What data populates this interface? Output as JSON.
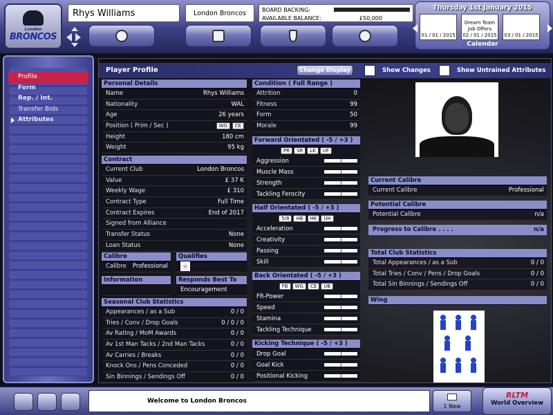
{
  "header": {
    "player_name": "Rhys Williams",
    "club": "London Broncos",
    "board_backing_label": "BOARD BACKING:",
    "available_balance_label": "AVAILABLE BALANCE:",
    "available_balance": "£50,000",
    "logo_small": "London",
    "logo_big": "BRONCOS"
  },
  "calendar": {
    "date": "Thursday 1st January 2015",
    "days": [
      {
        "event": "",
        "date": "01 / 01 / 2015"
      },
      {
        "event": "Dream Team Job Offers",
        "date": "02 / 01 / 2015"
      },
      {
        "event": "",
        "date": "03 / 01 / 2015"
      }
    ],
    "label": "Calendar"
  },
  "sidebar": {
    "items": [
      {
        "label": "Profile"
      },
      {
        "label": "Form"
      },
      {
        "label": "Rep. / Int."
      },
      {
        "label": "Transfer Bids"
      },
      {
        "label": "Attributes"
      }
    ]
  },
  "main": {
    "title": "Player Profile",
    "change_display": "Change Display",
    "show_changes": "Show Changes",
    "show_untrained": "Show Untrained Attributes"
  },
  "personal": {
    "header": "Personal Details",
    "name_k": "Name",
    "name_v": "Rhys Williams",
    "nat_k": "Nationality",
    "nat_v": "WAL",
    "age_k": "Age",
    "age_v": "26 years",
    "pos_k": "Position ( Prim / Sec )",
    "pos_v1": "WG",
    "pos_v2": "CE",
    "height_k": "Height",
    "height_v": "180 cm",
    "weight_k": "Weight",
    "weight_v": "95 kg"
  },
  "contract": {
    "header": "Contract",
    "rows": [
      {
        "k": "Current Club",
        "v": "London Broncos"
      },
      {
        "k": "Value",
        "v": "£ 37 K"
      },
      {
        "k": "Weekly Wage",
        "v": "£ 310"
      },
      {
        "k": "Contract Type",
        "v": "Full Time"
      },
      {
        "k": "Contract Expires",
        "v": "End of 2017"
      },
      {
        "k": "Signed from Alliance",
        "v": ""
      },
      {
        "k": "Transfer Status",
        "v": "None"
      },
      {
        "k": "Loan Status",
        "v": "None"
      }
    ]
  },
  "calibre": {
    "header": "Calibre",
    "k": "Calibre",
    "v": "Professional"
  },
  "qualifies": {
    "header": "Qualifies"
  },
  "information": {
    "header": "Information"
  },
  "responds": {
    "header": "Responds Best To",
    "v": "Encouragement"
  },
  "season": {
    "header": "Seasonal Club Statistics",
    "rows": [
      {
        "k": "Appearances / as a Sub",
        "v": "0 / 0"
      },
      {
        "k": "Tries / Conv / Drop Goals",
        "v": "0 / 0 / 0"
      },
      {
        "k": "Av Rating / MoM Awards",
        "v": "0 / 0"
      },
      {
        "k": "Av 1st Man Tacks / 2nd Man Tacks",
        "v": "0 / 0"
      },
      {
        "k": "Av Carries / Breaks",
        "v": "0 / 0"
      },
      {
        "k": "Knock Ons / Pens Conceded",
        "v": "0 / 0"
      },
      {
        "k": "Sin Binnings / Sendings Off",
        "v": "0 / 0"
      }
    ]
  },
  "condition": {
    "header": "Condition  ( Full Range )",
    "rows": [
      {
        "k": "Attrition",
        "v": "0"
      },
      {
        "k": "Fitness",
        "v": "99"
      },
      {
        "k": "Form",
        "v": "50"
      },
      {
        "k": "Morale",
        "v": "99"
      }
    ]
  },
  "forward": {
    "header": "Forward Orientated  ( -5 / +3 )",
    "tags": [
      "PR",
      "SR",
      "LK",
      "UF"
    ],
    "rows": [
      "Aggression",
      "Muscle Mass",
      "Strength",
      "Tackling Ferocity"
    ]
  },
  "half": {
    "header": "Half Orientated  ( -5 / +3 )",
    "tags": [
      "5/8",
      "HB",
      "HK",
      "UH"
    ],
    "rows": [
      "Acceleration",
      "Creativity",
      "Passing",
      "Skill"
    ]
  },
  "back": {
    "header": "Back Orientated  ( -5 / +3 )",
    "tags": [
      "FB",
      "WG",
      "CE",
      "UB"
    ],
    "rows": [
      "FR-Power",
      "Speed",
      "Stamina",
      "Tackling Technique"
    ]
  },
  "kicking": {
    "header": "Kicking Technique  ( -5 / +3 )",
    "rows": [
      "Drop Goal",
      "Goal Kick",
      "Positional Kicking"
    ]
  },
  "current_calibre": {
    "header": "Current Calibre",
    "k": "Current Calibre",
    "v": "Professional"
  },
  "potential": {
    "header": "Potential Calibre",
    "k": "Potential Calibre",
    "v": "n/a"
  },
  "progress": {
    "header": "Progress to Calibre . . . .",
    "v": "n/a"
  },
  "total": {
    "header": "Total Club Statistics",
    "rows": [
      {
        "k": "Total Appearances / as a Sub",
        "v": "0 / 0"
      },
      {
        "k": "Total Tries / Conv / Pens / Drop Goals",
        "v": "0 / 0"
      },
      {
        "k": "Total Sin Binnings / Sendings Off",
        "v": "0 / 0"
      }
    ]
  },
  "wing": {
    "header": "Wing"
  },
  "bottom": {
    "message": "Welcome to London Broncos",
    "new_label": "1 New",
    "world_overview": "World Overview",
    "logo_text": "RLTM"
  }
}
